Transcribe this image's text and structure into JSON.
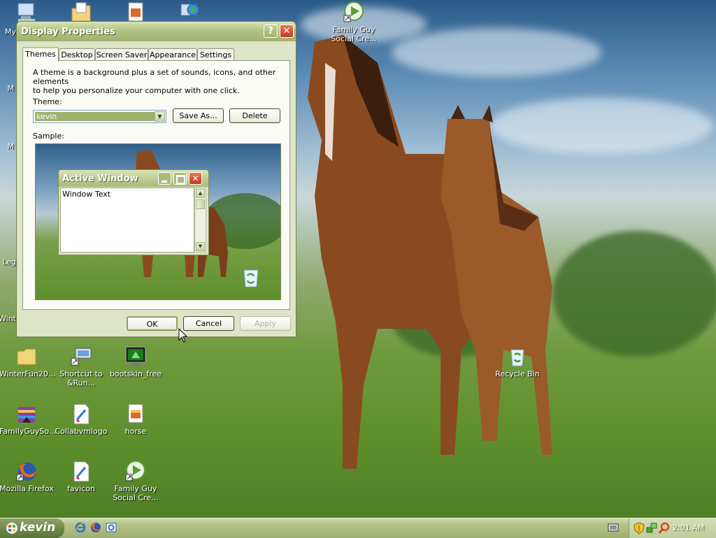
{
  "desktop_icons": [
    {
      "id": "my-computer",
      "label": "My",
      "x": "",
      "y": ""
    },
    {
      "id": "family-guy-top",
      "label": "Family Guy Social Cre..."
    },
    {
      "id": "winterfun",
      "label": "WinterFun20..."
    },
    {
      "id": "shortcut-run",
      "label": "Shortcut to &Run..."
    },
    {
      "id": "bootskin",
      "label": "bootskin_free"
    },
    {
      "id": "recycle-bin",
      "label": "Recycle Bin"
    },
    {
      "id": "familyguyso",
      "label": "FamilyGuySo..."
    },
    {
      "id": "collabvmlogo",
      "label": "Collabvmlogo"
    },
    {
      "id": "horse",
      "label": "horse"
    },
    {
      "id": "firefox",
      "label": "Mozilla Firefox"
    },
    {
      "id": "favicon",
      "label": "favicon"
    },
    {
      "id": "family-guy-bottom",
      "label": "Family Guy Social Cre..."
    }
  ],
  "edge_labels": {
    "legend": "Leg",
    "wint": "Wint",
    "m1": "M",
    "m2": "M"
  },
  "dialog": {
    "title": "Display Properties",
    "help_btn": "?",
    "close_btn": "✕",
    "tabs": [
      "Themes",
      "Desktop",
      "Screen Saver",
      "Appearance",
      "Settings"
    ],
    "active_tab": "Themes",
    "description_line1": "A theme is a background plus a set of sounds, icons, and other elements",
    "description_line2": "to help you personalize your computer with one click.",
    "theme_label": "Theme:",
    "theme_value": "kevin",
    "save_as": "Save As...",
    "delete": "Delete",
    "sample_label": "Sample:",
    "sample_window_title": "Active Window",
    "sample_window_text": "Window Text",
    "ok": "OK",
    "cancel": "Cancel",
    "apply": "Apply"
  },
  "taskbar": {
    "start_label": "kevin",
    "clock": "2:01 AM"
  },
  "colors": {
    "accent": "#9fb26e",
    "title_text": "#ffffff"
  }
}
